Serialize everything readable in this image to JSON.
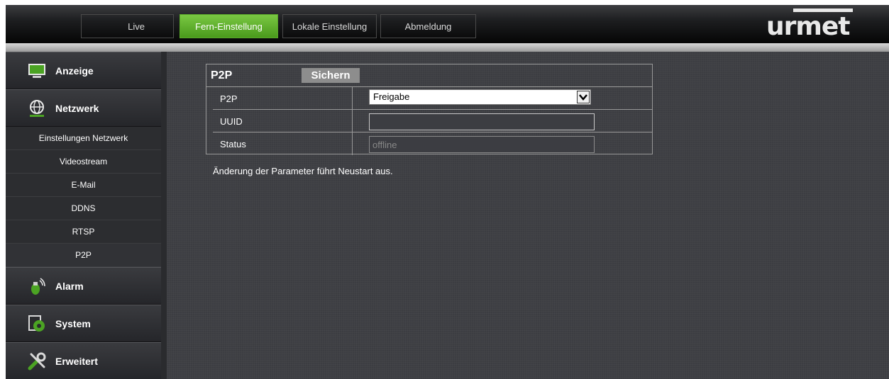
{
  "nav": {
    "tabs": [
      {
        "label": "Live",
        "active": false
      },
      {
        "label": "Fern-Einstellung",
        "active": true
      },
      {
        "label": "Lokale Einstellung",
        "active": false
      },
      {
        "label": "Abmeldung",
        "active": false
      }
    ],
    "logo_text": "urmet",
    "active_color": "#5cb02c"
  },
  "sidebar": {
    "sections": [
      {
        "label": "Anzeige",
        "icon": "monitor-icon"
      },
      {
        "label": "Netzwerk",
        "icon": "network-globe-icon"
      },
      {
        "label": "Alarm",
        "icon": "alarm-icon"
      },
      {
        "label": "System",
        "icon": "system-gear-icon"
      },
      {
        "label": "Erweitert",
        "icon": "tools-icon"
      }
    ],
    "network_items": [
      {
        "label": "Einstellungen Netzwerk"
      },
      {
        "label": "Videostream"
      },
      {
        "label": "E-Mail"
      },
      {
        "label": "DDNS"
      },
      {
        "label": "RTSP"
      },
      {
        "label": "P2P",
        "selected": true
      }
    ]
  },
  "panel": {
    "title": "P2P",
    "save_label": "Sichern",
    "rows": [
      {
        "label": "P2P",
        "type": "select",
        "value": "Freigabe"
      },
      {
        "label": "UUID",
        "type": "text",
        "value": ""
      },
      {
        "label": "Status",
        "type": "text",
        "value": "offline"
      }
    ]
  },
  "notice": "Änderung der Parameter führt Neustart aus."
}
